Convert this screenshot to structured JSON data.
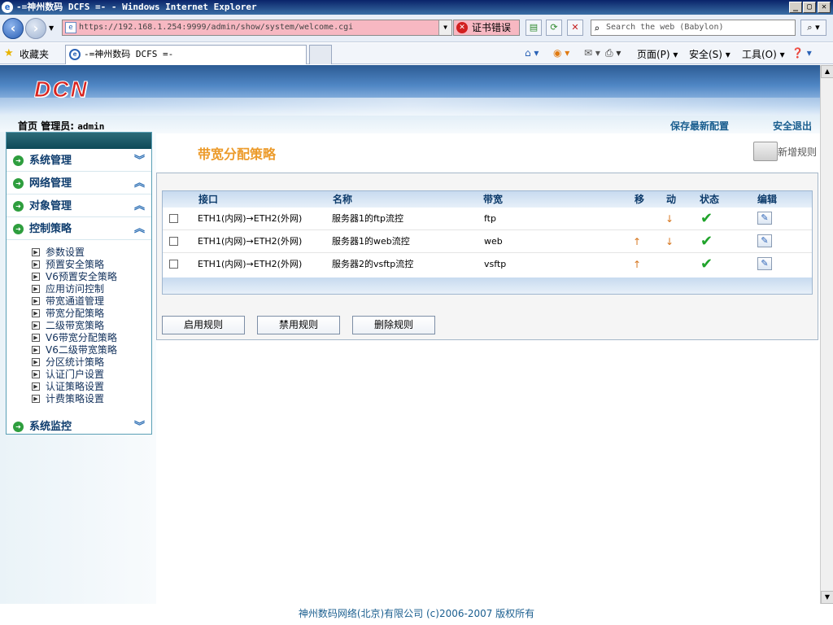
{
  "window": {
    "title": "-=神州数码 DCFS =- - Windows Internet Explorer",
    "min": "_",
    "max": "▢",
    "close": "✕"
  },
  "navbar": {
    "address": "https://192.168.1.254:9999/admin/show/system/welcome.cgi",
    "cert_error": "证书错误",
    "search_placeholder": "Search the web (Babylon)"
  },
  "favbar": {
    "favorites_label": "收藏夹",
    "tab_title": "-=神州数码 DCFS =-",
    "page_menu": "页面(P)",
    "safety_menu": "安全(S)",
    "tools_menu": "工具(O)"
  },
  "header": {
    "logo": "DCN",
    "home": "首页",
    "admin_label": "管理员:",
    "admin_name": "admin",
    "save_config": "保存最新配置",
    "logout": "安全退出"
  },
  "sidebar": {
    "sections": [
      {
        "label": "系统管理",
        "chevron": "︾"
      },
      {
        "label": "网络管理",
        "chevron": "︽"
      },
      {
        "label": "对象管理",
        "chevron": "︽"
      },
      {
        "label": "控制策略",
        "chevron": "︽"
      }
    ],
    "items": [
      "参数设置",
      "预置安全策略",
      "V6预置安全策略",
      "应用访问控制",
      "带宽通道管理",
      "带宽分配策略",
      "二级带宽策略",
      "V6带宽分配策略",
      "V6二级带宽策略",
      "分区统计策略",
      "认证门户设置",
      "认证策略设置",
      "计费策略设置"
    ],
    "last_section": {
      "label": "系统监控",
      "chevron": "︾"
    }
  },
  "main": {
    "title": "带宽分配策略",
    "new_rule": "新增规则",
    "table": {
      "headers": {
        "interface": "接口",
        "name": "名称",
        "bandwidth": "带宽",
        "move1": "移",
        "move2": "动",
        "status": "状态",
        "edit": "编辑"
      },
      "rows": [
        {
          "interface": "ETH1(内网)→ETH2(外网)",
          "name": "服务器1的ftp流控",
          "bandwidth": "ftp",
          "up": "",
          "down": "↓"
        },
        {
          "interface": "ETH1(内网)→ETH2(外网)",
          "name": "服务器1的web流控",
          "bandwidth": "web",
          "up": "↑",
          "down": "↓"
        },
        {
          "interface": "ETH1(内网)→ETH2(外网)",
          "name": "服务器2的vsftp流控",
          "bandwidth": "vsftp",
          "up": "↑",
          "down": ""
        }
      ]
    },
    "buttons": {
      "enable": "启用规则",
      "disable": "禁用规则",
      "delete": "删除规则"
    }
  },
  "footer": "神州数码网络(北京)有限公司 (c)2006-2007 版权所有",
  "icons": {
    "status_ok": "check-icon",
    "edit": "edit-icon"
  }
}
